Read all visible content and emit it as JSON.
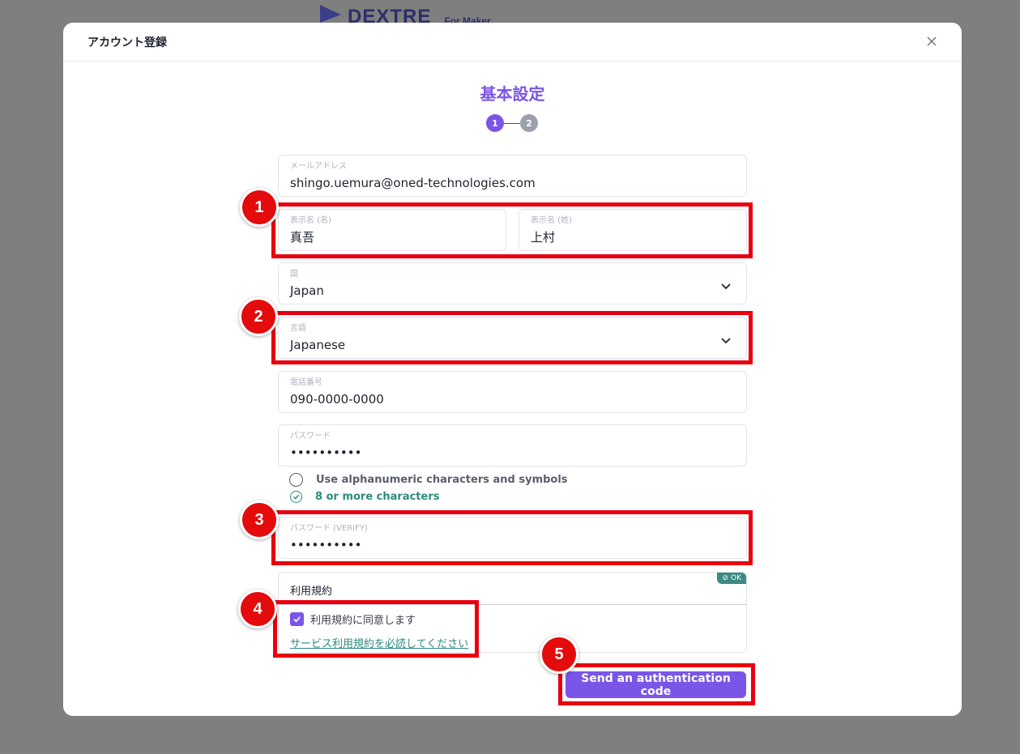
{
  "background": {
    "logo_text": "DEXTRE",
    "logo_sub": "For Maker"
  },
  "modal": {
    "title": "アカウント登録",
    "step_title": "基本設定",
    "steps": [
      "1",
      "2"
    ]
  },
  "form": {
    "email": {
      "label": "メールアドレス",
      "value": "shingo.uemura@oned-technologies.com"
    },
    "first_name": {
      "label": "表示名 (名)",
      "value": "真吾"
    },
    "last_name": {
      "label": "表示名 (姓)",
      "value": "上村"
    },
    "country": {
      "label": "国",
      "value": "Japan"
    },
    "language": {
      "label": "言語",
      "value": "Japanese"
    },
    "phone": {
      "label": "電話番号",
      "value": "090-0000-0000"
    },
    "password": {
      "label": "パスワード",
      "value": "••••••••••"
    },
    "password_hints": [
      {
        "text": "Use alphanumeric characters and symbols",
        "state": "unmet"
      },
      {
        "text": "8 or more characters",
        "state": "met"
      }
    ],
    "password_verify": {
      "label": "パスワード (VERIFY)",
      "value": "••••••••••"
    },
    "terms": {
      "title": "利用規約",
      "badge": "OK",
      "agree_label": "利用規約に同意します",
      "agree_checked": true,
      "link_text": "サービス利用規約を必読してください"
    },
    "submit_label": "Send an authentication code"
  },
  "annotations": [
    "1",
    "2",
    "3",
    "4",
    "5"
  ],
  "colors": {
    "accent": "#7b55e8",
    "success": "#2e8a7f",
    "annotation": "#e8000f"
  }
}
